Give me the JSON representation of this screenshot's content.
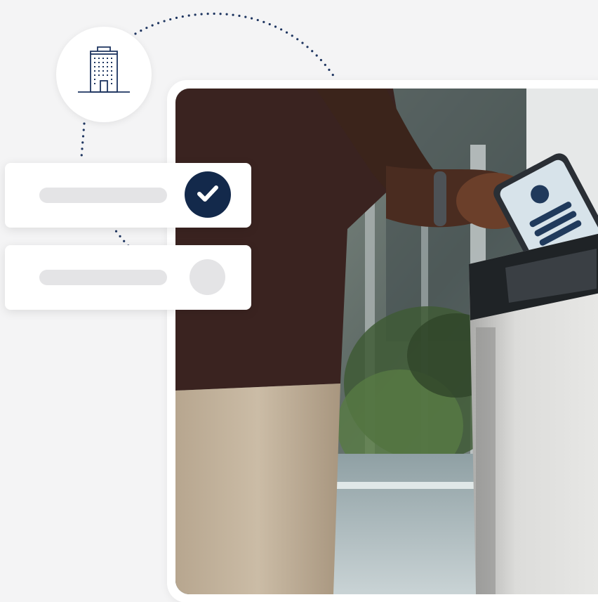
{
  "icons": {
    "building": "office-building-icon",
    "check": "checkmark-icon"
  },
  "colors": {
    "navy": "#13294b",
    "placeholder": "#e4e4e6",
    "background": "#f4f4f5",
    "card": "#ffffff"
  },
  "status_items": [
    {
      "state": "completed"
    },
    {
      "state": "pending"
    }
  ]
}
